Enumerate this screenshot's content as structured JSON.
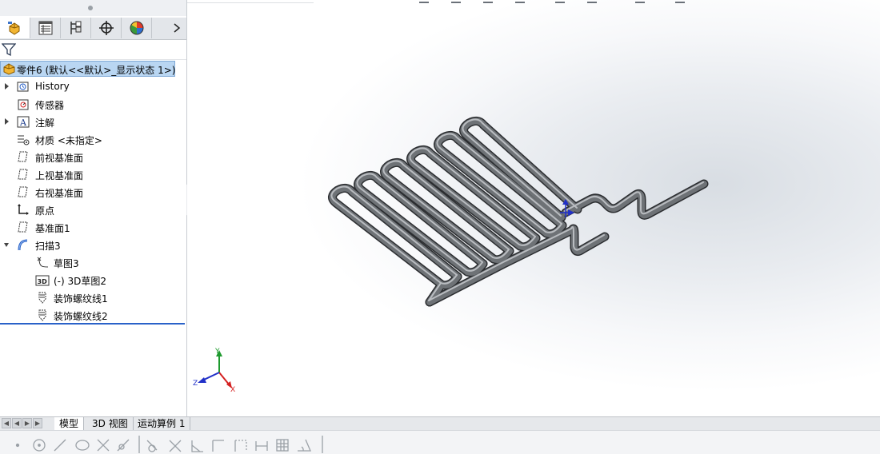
{
  "tabs": [
    {
      "name": "feature-manager",
      "icon": "feature-manager-icon",
      "active": true
    },
    {
      "name": "property-manager",
      "icon": "property-manager-icon",
      "active": false
    },
    {
      "name": "configuration-manager",
      "icon": "configuration-manager-icon",
      "active": false
    },
    {
      "name": "dimxpert-manager",
      "icon": "dimxpert-icon",
      "active": false
    },
    {
      "name": "display-manager",
      "icon": "display-manager-icon",
      "active": false
    }
  ],
  "tree": {
    "root": "零件6  (默认<<默认>_显示状态 1>)",
    "items": [
      {
        "label": "History",
        "icon": "history-folder-icon",
        "expander": true
      },
      {
        "label": "传感器",
        "icon": "sensors-icon",
        "expander": false
      },
      {
        "label": "注解",
        "icon": "annotations-icon",
        "expander": true
      },
      {
        "label": "材质 <未指定>",
        "icon": "material-icon",
        "expander": false
      },
      {
        "label": "前视基准面",
        "icon": "plane-icon",
        "expander": false
      },
      {
        "label": "上视基准面",
        "icon": "plane-icon",
        "expander": false
      },
      {
        "label": "右视基准面",
        "icon": "plane-icon",
        "expander": false
      },
      {
        "label": "原点",
        "icon": "origin-icon",
        "expander": false
      },
      {
        "label": "基准面1",
        "icon": "plane-icon",
        "expander": false
      },
      {
        "label": "扫描3",
        "icon": "sweep-icon",
        "expander": true,
        "expanded": true
      },
      {
        "label": "草图3",
        "icon": "sketch-icon",
        "child": true
      },
      {
        "label": "(-) 3D草图2",
        "icon": "3d-sketch-icon",
        "child": true
      },
      {
        "label": "装饰螺纹线1",
        "icon": "cosmetic-thread-icon",
        "child": true
      },
      {
        "label": "装饰螺纹线2",
        "icon": "cosmetic-thread-icon",
        "child": true
      }
    ]
  },
  "triad": {
    "x": "X",
    "y": "Y",
    "z": "Z"
  },
  "bottom_tabs": [
    {
      "label": "模型",
      "active": true
    },
    {
      "label": "3D 视图",
      "active": false
    },
    {
      "label": "运动算例 1",
      "active": false
    }
  ],
  "colors": {
    "selection": "#b9d6f2",
    "tube": "#6e7276",
    "tube_edge": "#2b2d30",
    "axis_x": "#d42020",
    "axis_y": "#1e9a2e",
    "axis_z": "#2130c8"
  }
}
